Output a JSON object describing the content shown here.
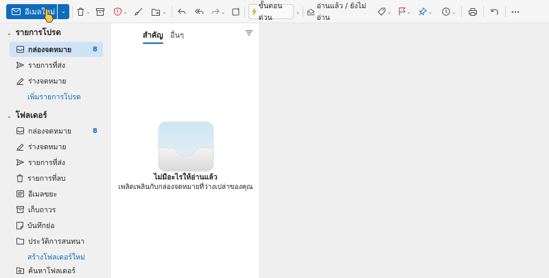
{
  "toolbar": {
    "new_mail_label": "อีเมลใหม่",
    "quick_steps_label": "ขั้นตอนด่วน",
    "read_unread_label": "อ่านแล้ว / ยังไม่อ่าน",
    "more_label": "···",
    "icons": [
      "mail-icon",
      "delete-icon",
      "archive-icon",
      "report-icon",
      "sweep-icon",
      "move-to-icon",
      "reply-icon",
      "reply-all-icon",
      "forward-icon",
      "add-to-icon",
      "lightning-icon",
      "envelope-open-icon",
      "tag-icon",
      "flag-icon",
      "pin-icon",
      "clock-icon",
      "print-icon",
      "undo-icon"
    ]
  },
  "sidebar": {
    "favorites": {
      "title": "รายการโปรด",
      "items": [
        {
          "label": "กล่องจดหมาย",
          "count": "8",
          "icon": "inbox-icon"
        },
        {
          "label": "รายการที่ส่ง",
          "icon": "send-icon"
        },
        {
          "label": "ร่างจดหมาย",
          "icon": "draft-icon"
        },
        {
          "label": "เพิ่มรายการโปรด"
        }
      ]
    },
    "folders": {
      "title": "โฟลเดอร์",
      "items": [
        {
          "label": "กล่องจดหมาย",
          "count": "8",
          "icon": "inbox-icon"
        },
        {
          "label": "ร่างจดหมาย",
          "icon": "draft-icon"
        },
        {
          "label": "รายการที่ส่ง",
          "icon": "send-icon"
        },
        {
          "label": "รายการที่ลบ",
          "icon": "trash-icon"
        },
        {
          "label": "อีเมลขยะ",
          "icon": "junk-icon"
        },
        {
          "label": "เก็บถาวร",
          "icon": "archive-icon"
        },
        {
          "label": "บันทึกย่อ",
          "icon": "notes-icon"
        },
        {
          "label": "ประวัติการสนทนา",
          "icon": "folder-icon"
        },
        {
          "label": "สร้างโฟลเดอร์ใหม่"
        },
        {
          "label": "ค้นหาโฟลเดอร์",
          "icon": "search-folder-icon"
        }
      ]
    }
  },
  "list": {
    "tabs": [
      {
        "label": "สำคัญ",
        "active": true
      },
      {
        "label": "อื่นๆ",
        "active": false
      }
    ],
    "empty_title": "ไม่มีอะไรให้อ่านแล้ว",
    "empty_subtitle": "เพลิดเพลินกับกล่องจดหมายที่ว่างเปล่าของคุณ"
  },
  "colors": {
    "accent": "#0f6cbd",
    "selected": "#cfe3f7",
    "flag": "#c4314b",
    "report": "#d13438",
    "quick": "#c19c00"
  }
}
